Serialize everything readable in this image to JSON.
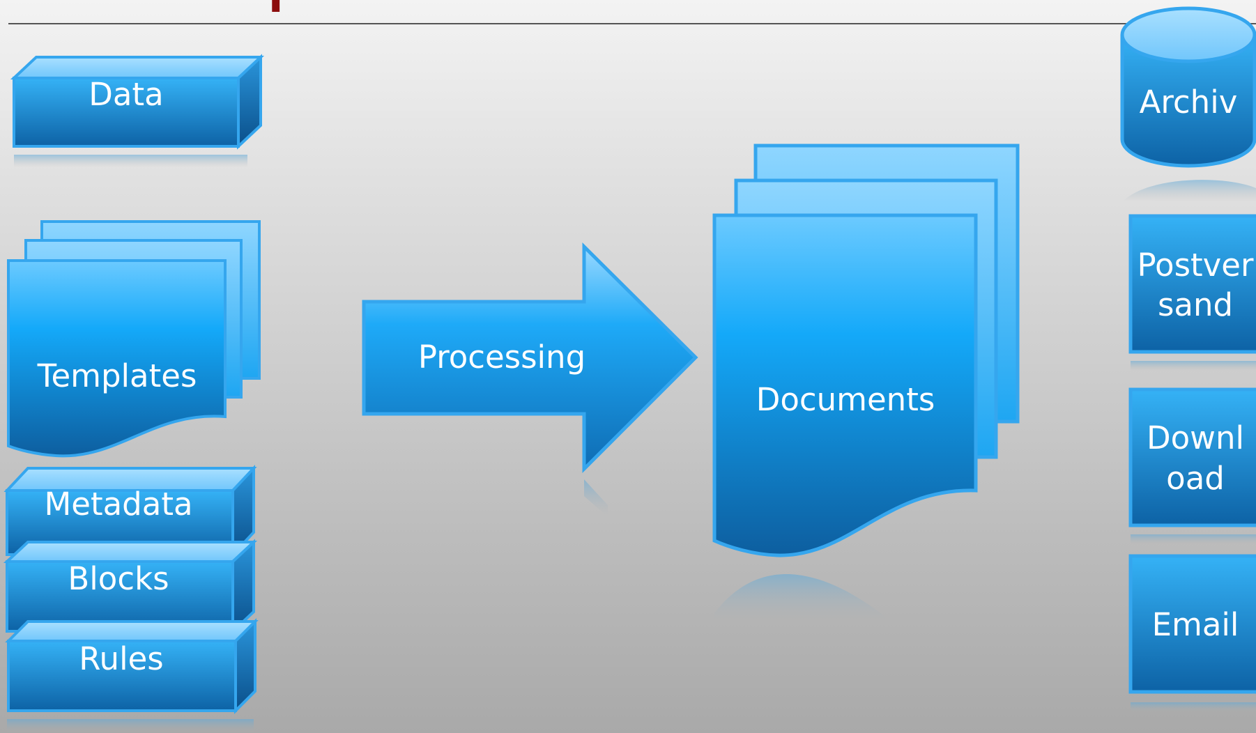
{
  "colors": {
    "shape_top": "#8fd4ff",
    "shape_face_light": "#35b2f6",
    "shape_face_dark": "#0d62a5",
    "shape_stroke": "#35a6ee",
    "label_text": "#ffffff",
    "title_fragment": "#8c0d0d",
    "divider": "#555555"
  },
  "inputs": {
    "data": "Data",
    "templates": "Templates",
    "metadata": "Metadata",
    "blocks": "Blocks",
    "rules": "Rules"
  },
  "process": {
    "label": "Processing"
  },
  "output": {
    "label": "Documents"
  },
  "channels": {
    "archive": "Archiv",
    "postal_line1": "Postver",
    "postal_line2": "sand",
    "download_line1": "Downl",
    "download_line2": "oad",
    "email": "Email"
  }
}
